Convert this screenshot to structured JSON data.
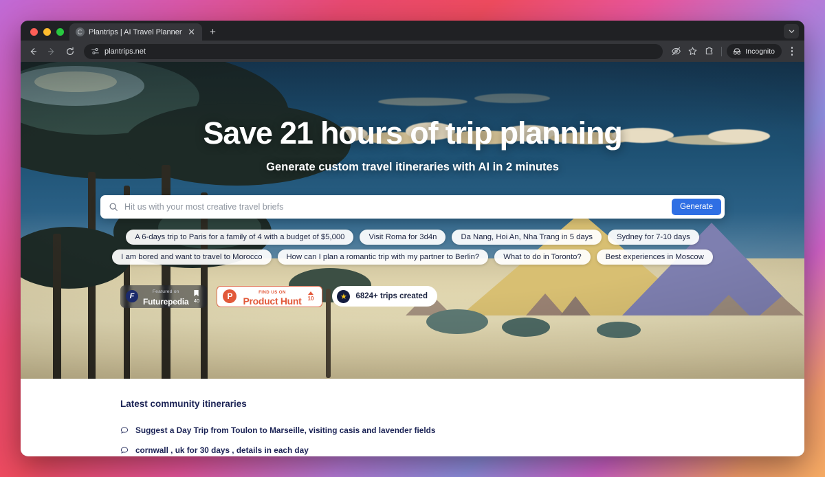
{
  "browser": {
    "tab": {
      "title": "Plantrips | AI Travel Planner",
      "favicon": "globe-icon",
      "close": "✕"
    },
    "new_tab_label": "+",
    "tabstrip_chevron": "⌄",
    "nav": {
      "back": "←",
      "forward": "→",
      "reload": "⟳"
    },
    "omnibox": {
      "url": "plantrips.net",
      "site_icon": "tune-icon"
    },
    "toolbar_icons": [
      "eye-off-icon",
      "star-icon",
      "extensions-icon"
    ],
    "incognito_label": "Incognito",
    "menu": "kebab-menu"
  },
  "hero": {
    "headline": "Save 21 hours of trip planning",
    "subheadline": "Generate custom travel itineraries with AI in 2 minutes",
    "search": {
      "placeholder": "Hit us with your most creative travel briefs",
      "value": "",
      "icon": "search-icon",
      "button_label": "Generate"
    },
    "chips": [
      "A 6-days trip to Paris for a family of 4 with a budget of $5,000",
      "Visit Roma for 3d4n",
      "Da Nang, Hoi An, Nha Trang in 5 days",
      "Sydney for 7-10 days",
      "I am bored and want to travel to Morocco",
      "How can I plan a romantic trip with my partner to Berlin?",
      "What to do in Toronto?",
      "Best experiences in Moscow"
    ],
    "badges": {
      "futurepedia": {
        "logo": "F",
        "kicker": "Featured on",
        "name": "Futurepedia",
        "bookmark_icon": "bookmark-icon",
        "count": "40"
      },
      "product_hunt": {
        "logo": "P",
        "kicker": "FIND US ON",
        "name": "Product Hunt",
        "upvote_icon": "upvote-triangle-icon",
        "count": "10"
      },
      "trips": {
        "star_icon": "★",
        "label": "6824+ trips created"
      }
    }
  },
  "community": {
    "title": "Latest community itineraries",
    "items": [
      "Suggest a Day Trip from Toulon to Marseille, visiting casis and lavender fields",
      "cornwall , uk for 30 days , details in each day"
    ]
  },
  "colors": {
    "accent_blue": "#2f6fe4",
    "navy_text": "#1b2355",
    "product_hunt": "#e2593a",
    "sky": "#1d4e6e",
    "sand": "#ded3ac"
  }
}
